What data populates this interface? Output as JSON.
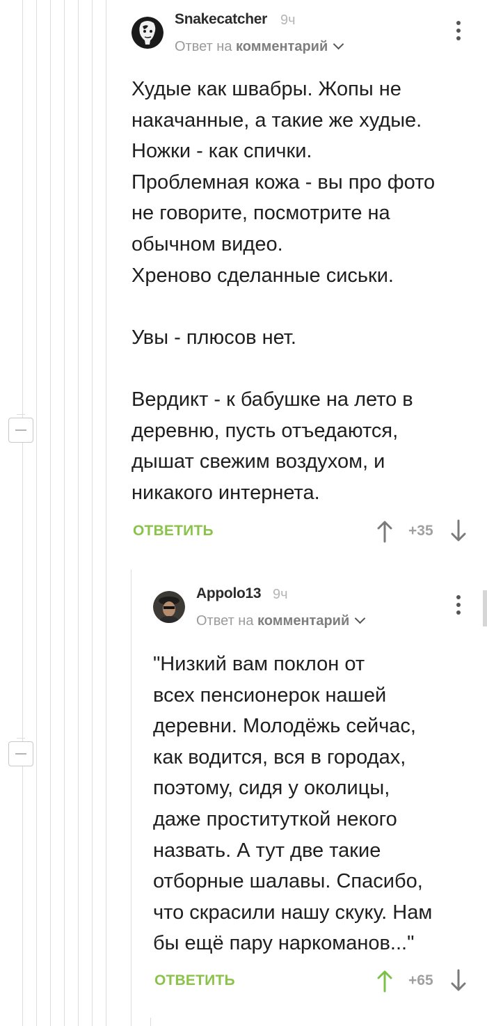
{
  "comments": [
    {
      "author": "Snakecatcher",
      "time": "9ч",
      "reply_prefix": "Ответ на",
      "reply_target": "комментарий",
      "body": "Худые как швабры. Жопы не\nнакачанные, а такие же худые.\nНожки - как спички.\nПроблемная кожа - вы про фото\nне говорите, посмотрите на\nобычном видео.\nХреново сделанные сиськи.\n\nУвы - плюсов нет.\n\nВердикт - к бабушке на лето в\nдеревню, пусть отъедаются,\nдышат свежим воздухом, и\nникакого интернета.",
      "reply_label": "ОТВЕТИТЬ",
      "rating": "+35"
    },
    {
      "author": "Appolo13",
      "time": "9ч",
      "reply_prefix": "Ответ на",
      "reply_target": "комментарий",
      "body": "\"Низкий вам поклон от\nвсех пенсионерок нашей\nдеревни. Молодёжь сейчас,\nкак водится, вся в городах,\nпоэтому, сидя у околицы,\nдаже проституткой некого\nназвать. А тут две такие\nотборные шалавы. Спасибо,\nчто скрасили нашу скуку. Нам\nбы ещё пару наркоманов...\"",
      "reply_label": "ОТВЕТИТЬ",
      "rating": "+65"
    }
  ],
  "colors": {
    "accent_green": "#8bc34a",
    "upvoted_green": "#7cc04a",
    "text": "#1e1e1e",
    "muted": "#9a9a9a"
  },
  "icons": [
    "avatar-snakecatcher",
    "avatar-appolo13",
    "more-vert-icon",
    "chevron-down-icon",
    "upvote-arrow-icon",
    "downvote-arrow-icon",
    "collapse-icon"
  ]
}
